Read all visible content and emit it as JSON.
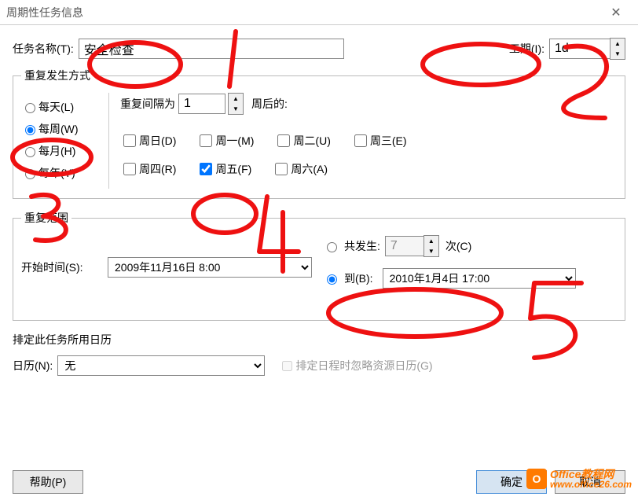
{
  "window": {
    "title": "周期性任务信息"
  },
  "task": {
    "name_label": "任务名称(T):",
    "name_value": "安全检查",
    "duration_label": "工期(I):",
    "duration_value": "1d"
  },
  "recurrence": {
    "legend": "重复发生方式",
    "pattern_options": {
      "daily": "每天(L)",
      "weekly": "每周(W)",
      "monthly": "每月(H)",
      "yearly": "每年(Y)"
    },
    "pattern_selected": "weekly",
    "interval_prefix": "重复间隔为",
    "interval_value": "1",
    "interval_suffix": "周后的:",
    "days": {
      "sun": {
        "label": "周日(D)",
        "checked": false
      },
      "mon": {
        "label": "周一(M)",
        "checked": false
      },
      "tue": {
        "label": "周二(U)",
        "checked": false
      },
      "wed": {
        "label": "周三(E)",
        "checked": false
      },
      "thu": {
        "label": "周四(R)",
        "checked": false
      },
      "fri": {
        "label": "周五(F)",
        "checked": true
      },
      "sat": {
        "label": "周六(A)",
        "checked": false
      }
    }
  },
  "range": {
    "legend": "重复范围",
    "start_label": "开始时间(S):",
    "start_value": "2009年11月16日 8:00",
    "occurrences_label": "共发生:",
    "occurrences_value": "7",
    "occurrences_suffix": "次(C)",
    "endby_label": "到(B):",
    "endby_value": "2010年1月4日 17:00",
    "end_mode": "endby"
  },
  "calendar": {
    "section_label": "排定此任务所用日历",
    "label": "日历(N):",
    "value": "无",
    "ignore_label": "排定日程时忽略资源日历(G)",
    "ignore_checked": false
  },
  "footer": {
    "help": "帮助(P)",
    "ok": "确定",
    "cancel": "取消"
  },
  "watermark": {
    "brand": "Office教程网",
    "url": "www.office26.com",
    "logo_letter": "O"
  },
  "annotations": [
    "1",
    "2",
    "3",
    "4",
    "5"
  ]
}
